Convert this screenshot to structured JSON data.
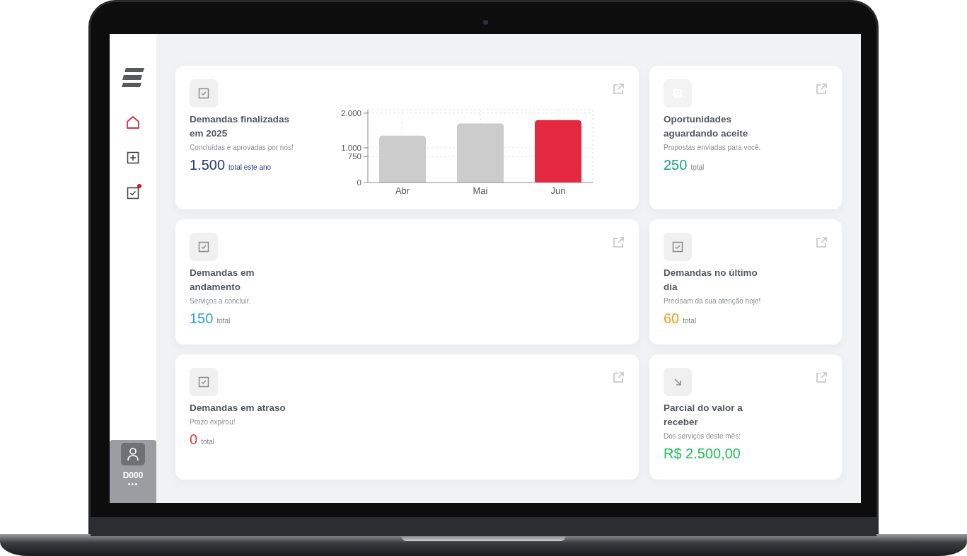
{
  "sidebar": {
    "items": [
      {
        "kind": "home",
        "selected": true,
        "notification": false
      },
      {
        "kind": "add",
        "selected": false,
        "notification": false
      },
      {
        "kind": "tasks",
        "selected": false,
        "notification": true
      }
    ],
    "user": {
      "code": "D000",
      "menu": "•••"
    }
  },
  "cards": [
    {
      "kind": "task",
      "title": "Demandas finalizadas em 2025",
      "subtitle": "Concluídas e aprovadas por nós!",
      "value": "1.500",
      "unit": "total este ano",
      "color": "#27357e",
      "chart_data": {
        "type": "bar",
        "categories": [
          "Abr",
          "Mai",
          "Jun"
        ],
        "grid": true,
        "series": [
          {
            "color": "#cccccc",
            "values": [
              1350,
              1700,
              null
            ]
          },
          {
            "color": "#e32940",
            "values": [
              null,
              null,
              1800
            ]
          }
        ],
        "ylim": [
          0,
          2100
        ],
        "yticks": [
          {
            "value": 0,
            "label": "0"
          },
          {
            "value": 750,
            "label": "750"
          },
          {
            "value": 1000,
            "label": "1.000"
          },
          {
            "value": 2000,
            "label": "2.000"
          }
        ]
      }
    },
    {
      "kind": "board",
      "title": "Oportunidades aguardando aceite",
      "subtitle": "Propostas enviadas para você.",
      "value": "250",
      "unit": "total",
      "color": "#1aa383"
    },
    {
      "kind": "task",
      "title": "Demandas em andamento",
      "subtitle": "Serviços a concluir.",
      "value": "150",
      "unit": "total",
      "color": "#2d9cf0"
    },
    {
      "kind": "task",
      "title": "Demandas no último dia",
      "subtitle": "Precisam da sua atenção hoje!",
      "value": "60",
      "unit": "total",
      "color": "#f29a13"
    },
    {
      "kind": "task",
      "title": "Demandas em atraso",
      "subtitle": "Prazo expirou!",
      "value": "0",
      "unit": "total",
      "color": "#e0393e"
    },
    {
      "kind": "payment",
      "title": "Parcial do valor a receber",
      "subtitle": "Dos serviços deste mês:",
      "value": "R$ 2.500,00",
      "color": "#22c05a"
    }
  ]
}
